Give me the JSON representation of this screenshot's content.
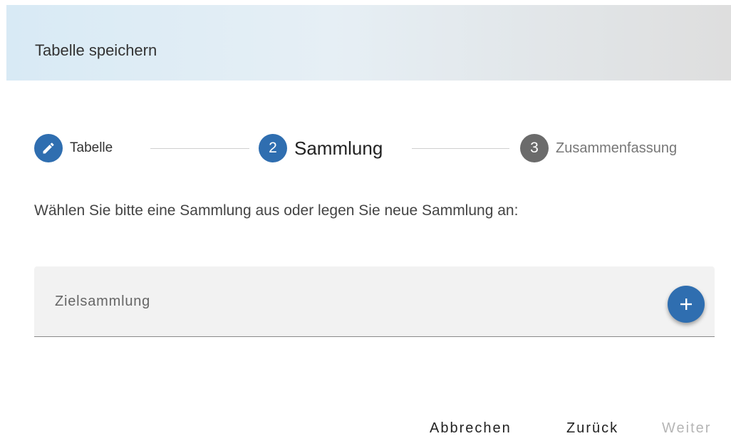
{
  "dialog": {
    "title": "Tabelle speichern"
  },
  "stepper": {
    "steps": [
      {
        "number": "",
        "label": "Tabelle",
        "state": "done",
        "icon": "pencil-icon"
      },
      {
        "number": "2",
        "label": "Sammlung",
        "state": "active"
      },
      {
        "number": "3",
        "label": "Zusammenfassung",
        "state": "idle"
      }
    ]
  },
  "content": {
    "instruction": "Wählen Sie bitte eine Sammlung aus oder legen Sie neue Sammlung an:",
    "target_collection": {
      "placeholder": "Zielsammlung",
      "value": "",
      "add_icon": "plus-icon"
    }
  },
  "actions": {
    "cancel_label": "Abbrechen",
    "back_label": "Zurück",
    "next_label": "Weiter"
  },
  "colors": {
    "primary": "#2f6eb0",
    "inactive_step": "#6b6b6b",
    "disabled_text": "#b5b5b5"
  }
}
